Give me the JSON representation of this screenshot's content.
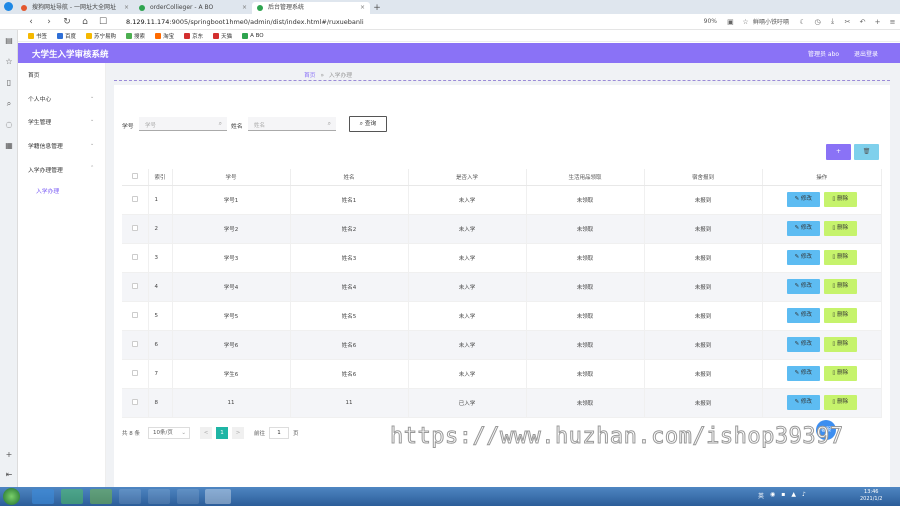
{
  "browser": {
    "tabs": [
      {
        "label": "搜狗网址导航 - 一网址大全网址",
        "color": "#e4572e",
        "active": false
      },
      {
        "label": "orderCollieger - A BO",
        "color": "#2ea44f",
        "active": false
      },
      {
        "label": "后台管理系统",
        "color": "#2ea44f",
        "active": true
      }
    ],
    "url_host": "8.129.11.174",
    "url_rest": ":9005/springboot1hme0/admin/dist/index.html#/ruxuebanli",
    "zoom": "90%",
    "right_text": "鲜嗝小铁吁嗝",
    "bookmarks": [
      {
        "label": "书签",
        "color": "#f5b800"
      },
      {
        "label": "百度",
        "color": "#2f6fd6"
      },
      {
        "label": "苏宁易购",
        "color": "#f5b800"
      },
      {
        "label": "搜索",
        "color": "#4caf50"
      },
      {
        "label": "淘宝",
        "color": "#ff6a00"
      },
      {
        "label": "京东",
        "color": "#d32f2f"
      },
      {
        "label": "天猫",
        "color": "#d32f2f"
      },
      {
        "label": "A BO",
        "color": "#2ea44f"
      }
    ]
  },
  "app": {
    "title": "大学生入学审核系统",
    "user_label": "管理员 abo",
    "logout_label": "退出登录",
    "accent": "#8a72f6"
  },
  "sidebar": {
    "items": [
      {
        "label": "首页",
        "chevron": false
      },
      {
        "label": "个人中心",
        "chevron": true
      },
      {
        "label": "学生管理",
        "chevron": true
      },
      {
        "label": "学籍信息管理",
        "chevron": true
      },
      {
        "label": "入学办理管理",
        "chevron": true
      }
    ],
    "subitem": "入学办理"
  },
  "breadcrumb": {
    "home": "首页",
    "sep": "»",
    "current": "入学办理"
  },
  "search": {
    "student_id_label": "学号",
    "student_id_placeholder": "学号",
    "name_label": "姓名",
    "name_placeholder": "姓名",
    "query_button": "查询"
  },
  "actions": {
    "add": "+",
    "delete": "🗑"
  },
  "table": {
    "headers": [
      "索引",
      "学号",
      "姓名",
      "是否入学",
      "生活用品领取",
      "宿舍报到",
      "操作"
    ],
    "edit_label": "修改",
    "delete_label": "删除",
    "rows": [
      {
        "index": "1",
        "sid": "学号1",
        "name": "姓名1",
        "enrolled": "未入学",
        "supplies": "未领取",
        "dorm": "未报到"
      },
      {
        "index": "2",
        "sid": "学号2",
        "name": "姓名2",
        "enrolled": "未入学",
        "supplies": "未领取",
        "dorm": "未报到"
      },
      {
        "index": "3",
        "sid": "学号3",
        "name": "姓名3",
        "enrolled": "未入学",
        "supplies": "未领取",
        "dorm": "未报到"
      },
      {
        "index": "4",
        "sid": "学号4",
        "name": "姓名4",
        "enrolled": "未入学",
        "supplies": "未领取",
        "dorm": "未报到"
      },
      {
        "index": "5",
        "sid": "学号5",
        "name": "姓名5",
        "enrolled": "未入学",
        "supplies": "未领取",
        "dorm": "未报到"
      },
      {
        "index": "6",
        "sid": "学号6",
        "name": "姓名6",
        "enrolled": "未入学",
        "supplies": "未领取",
        "dorm": "未报到"
      },
      {
        "index": "7",
        "sid": "学生6",
        "name": "姓名6",
        "enrolled": "未入学",
        "supplies": "未领取",
        "dorm": "未报到"
      },
      {
        "index": "8",
        "sid": "11",
        "name": "11",
        "enrolled": "已入学",
        "supplies": "未领取",
        "dorm": "未报到"
      }
    ]
  },
  "pagination": {
    "total": "共 8 条",
    "page_size": "10条/页",
    "prev": "<",
    "current": "1",
    "next": ">",
    "goto_label": "前往",
    "goto_value": "1",
    "page_suffix": "页"
  },
  "fab_label": "客服",
  "watermark": "https://www.huzhan.com/ishop39397",
  "taskbar": {
    "tray_text": "英",
    "time": "13:46",
    "date": "2021/1/2"
  }
}
